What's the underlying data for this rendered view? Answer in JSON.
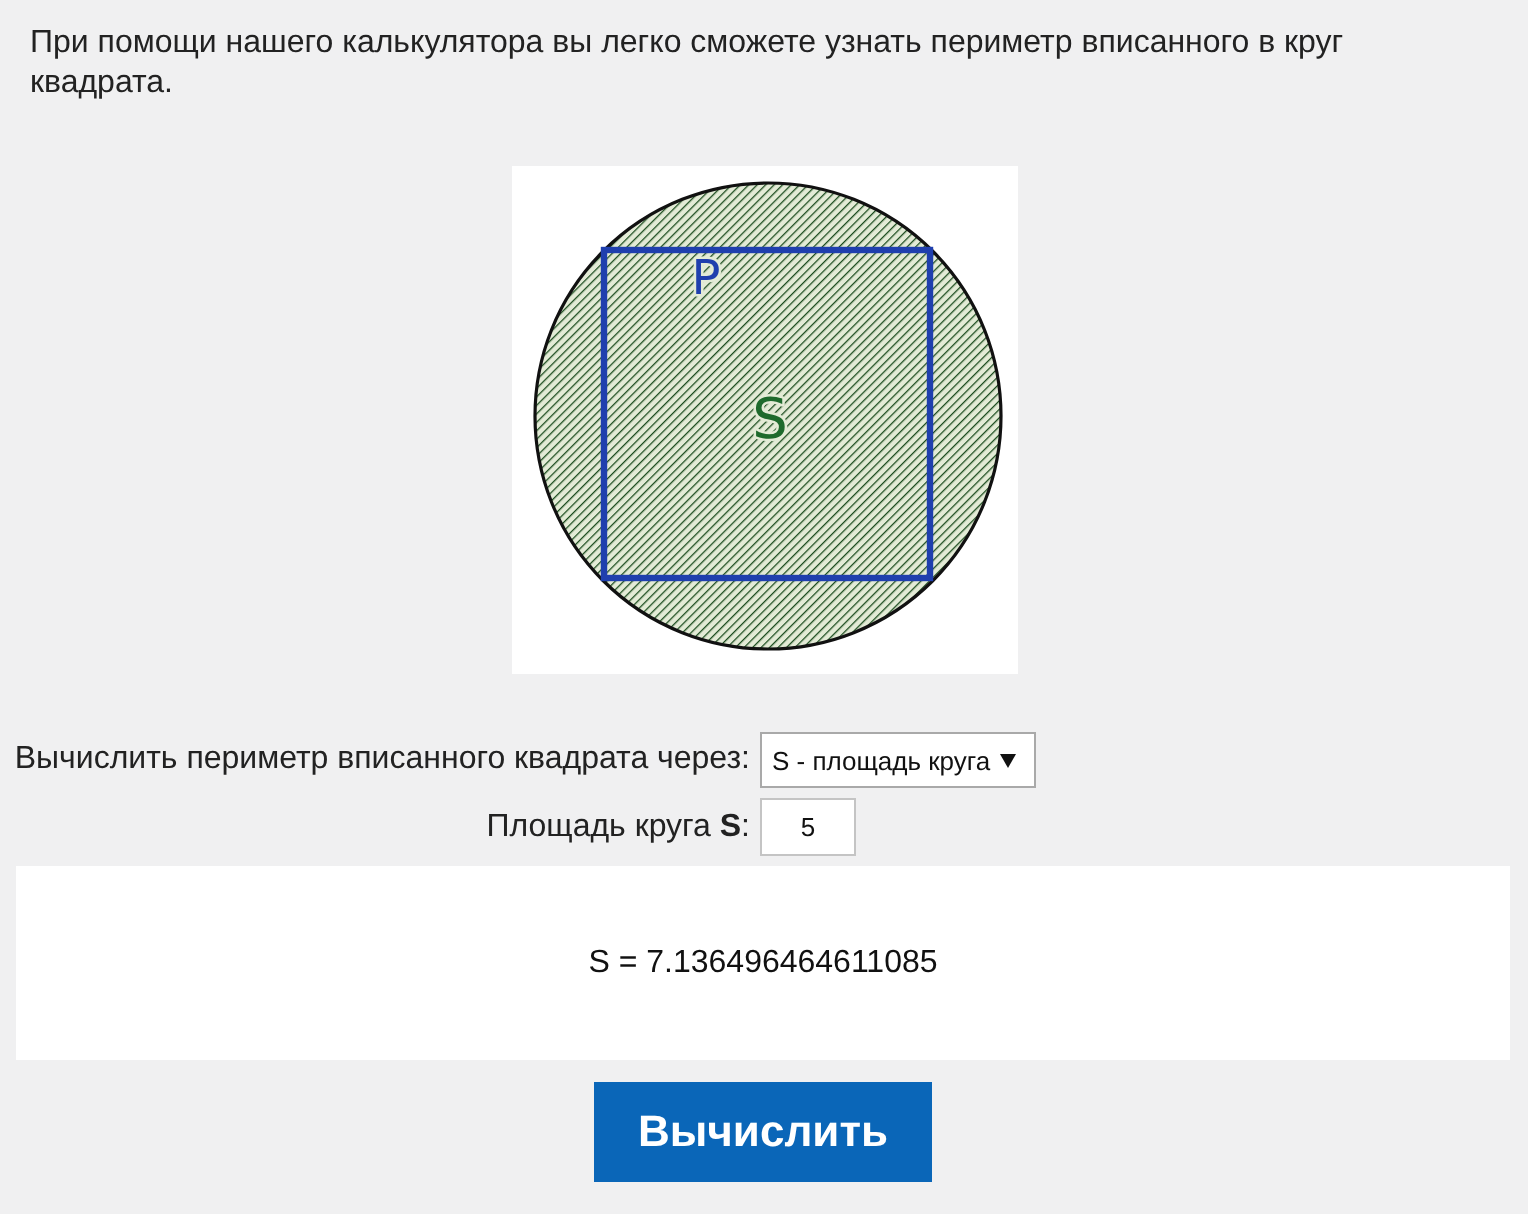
{
  "intro": "При помощи нашего калькулятора вы легко сможете узнать периметр вписанного в круг квадрата.",
  "figure": {
    "labels": [
      {
        "kind": "perimeter",
        "text": "P"
      },
      {
        "kind": "area",
        "text": "S"
      }
    ]
  },
  "form": {
    "rows": [
      {
        "kind": "select",
        "label": "Вычислить периметр вписанного квадрата через:",
        "value": "S - площадь круга"
      },
      {
        "kind": "input",
        "label": "Площадь круга **S**:",
        "value": "5"
      }
    ]
  },
  "result": "S = 7.136496464611085",
  "buttons": [
    {
      "label": "Вычислить"
    }
  ]
}
